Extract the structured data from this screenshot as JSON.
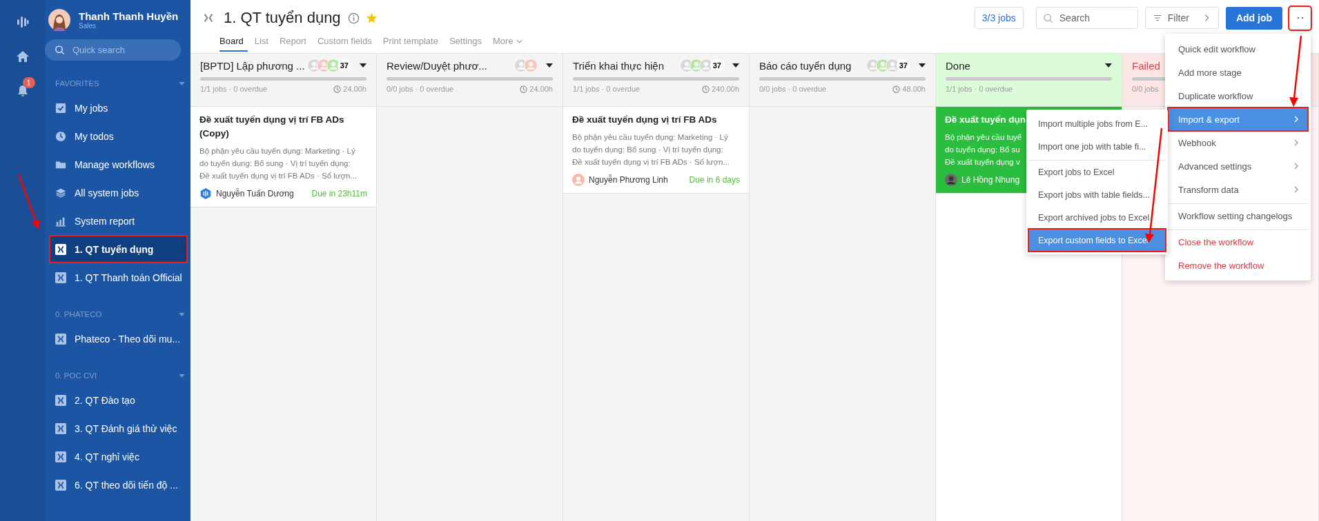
{
  "rail": {
    "notification_count": "1"
  },
  "user": {
    "name": "Thanh Thanh Huyền",
    "role": "Sales"
  },
  "quick_search": {
    "placeholder": "Quick search"
  },
  "sidebar_sections": [
    {
      "title": "FAVORITES",
      "items": [
        {
          "label": "My jobs",
          "selected": false,
          "annotated": false
        },
        {
          "label": "My todos",
          "selected": false,
          "annotated": false
        },
        {
          "label": "Manage workflows",
          "selected": false,
          "annotated": false
        },
        {
          "label": "All system jobs",
          "selected": false,
          "annotated": false
        },
        {
          "label": "System report",
          "selected": false,
          "annotated": false
        },
        {
          "label": "1. QT tuyển dụng",
          "selected": true,
          "annotated": true
        },
        {
          "label": "1. QT Thanh toán Official",
          "selected": false,
          "annotated": false
        }
      ]
    },
    {
      "title": "0. PHATECO",
      "items": [
        {
          "label": "Phateco - Theo dõi mu...",
          "selected": false,
          "annotated": false
        }
      ]
    },
    {
      "title": "0. POC CVI",
      "items": [
        {
          "label": "2. QT Đào tạo",
          "selected": false,
          "annotated": false
        },
        {
          "label": "3. QT Đánh giá thử việc",
          "selected": false,
          "annotated": false
        },
        {
          "label": "4. QT nghỉ việc",
          "selected": false,
          "annotated": false
        },
        {
          "label": "6. QT theo dõi tiến độ ...",
          "selected": false,
          "annotated": false
        }
      ]
    }
  ],
  "workflow": {
    "title": "1. QT tuyển dụng",
    "starred": true
  },
  "tabs": [
    {
      "label": "Board",
      "selected": true,
      "dropdown": false
    },
    {
      "label": "List",
      "selected": false,
      "dropdown": false
    },
    {
      "label": "Report",
      "selected": false,
      "dropdown": false
    },
    {
      "label": "Custom fields",
      "selected": false,
      "dropdown": false
    },
    {
      "label": "Print template",
      "selected": false,
      "dropdown": false
    },
    {
      "label": "Settings",
      "selected": false,
      "dropdown": false
    },
    {
      "label": "More",
      "selected": false,
      "dropdown": true
    }
  ],
  "toolbar": {
    "jobs_count": "3/3 jobs",
    "search_placeholder": "Search",
    "filter": "Filter",
    "add_job": "Add job",
    "more_annotated": true
  },
  "columns": [
    {
      "name": "[BPTD] Lập phương ...",
      "kind": "normal",
      "count": "37",
      "stats": "1/1 jobs · 0 overdue",
      "duration": "24.00h",
      "cards": [
        {
          "title": "Đề xuất tuyển dụng vị trí FB ADs (Copy)",
          "lines": [
            "Bộ phận yêu cầu tuyển dụng: Marketing · Lý",
            "do tuyển dụng: Bổ sung · Vị trí tuyển dụng:",
            "Đề xuất tuyển dụng vị trí FB ADs · Số lượn..."
          ],
          "assignee": "Nguyễn Tuấn Dương",
          "due": "Due in 23h11m"
        }
      ]
    },
    {
      "name": "Review/Duyệt phươ...",
      "kind": "normal",
      "stats": "0/0 jobs · 0 overdue",
      "duration": "24.00h"
    },
    {
      "name": "Triển khai thực hiện",
      "kind": "normal",
      "count": "37",
      "stats": "1/1 jobs · 0 overdue",
      "duration": "240.00h",
      "cards": [
        {
          "title": "Đề xuất tuyển dụng vị trí FB ADs",
          "lines": [
            "Bộ phận yêu cầu tuyển dụng: Marketing · Lý",
            "do tuyển dụng: Bổ sung · Vị trí tuyển dụng:",
            "Đề xuất tuyển dụng vị trí FB ADs · Số lượn..."
          ],
          "assignee": "Nguyễn Phương Linh",
          "due": "Due in 6 days"
        }
      ]
    },
    {
      "name": "Báo cáo tuyển dụng",
      "kind": "normal",
      "count": "37",
      "stats": "0/0 jobs · 0 overdue",
      "duration": "48.00h"
    },
    {
      "name": "Done",
      "kind": "done",
      "stats": "1/1 jobs · 0 overdue",
      "cards": [
        {
          "title": "Đề xuất tuyển dụn",
          "lines": [
            "Bộ phận yêu cầu tuyể",
            "do tuyển dụng: Bổ su",
            "Đề xuất tuyển dụng v"
          ],
          "assignee": "Lê Hồng Nhung"
        }
      ]
    },
    {
      "name": "Failed",
      "kind": "failed",
      "stats": "0/0 jobs"
    }
  ],
  "menu": [
    {
      "label": "Quick edit workflow",
      "kind": "normal",
      "submenu": false,
      "selected": false,
      "annotated": false,
      "divider_before": false
    },
    {
      "label": "Add more stage",
      "kind": "normal",
      "submenu": false,
      "selected": false,
      "annotated": false,
      "divider_before": false
    },
    {
      "label": "Duplicate workflow",
      "kind": "normal",
      "submenu": false,
      "selected": false,
      "annotated": false,
      "divider_before": false
    },
    {
      "label": "Import & export",
      "kind": "normal",
      "submenu": true,
      "selected": true,
      "annotated": true,
      "divider_before": false
    },
    {
      "label": "Webhook",
      "kind": "normal",
      "submenu": true,
      "selected": false,
      "annotated": false,
      "divider_before": false
    },
    {
      "label": "Advanced settings",
      "kind": "normal",
      "submenu": true,
      "selected": false,
      "annotated": false,
      "divider_before": false
    },
    {
      "label": "Transform data",
      "kind": "normal",
      "submenu": true,
      "selected": false,
      "annotated": false,
      "divider_before": false
    },
    {
      "label": "Workflow setting changelogs",
      "kind": "normal",
      "submenu": false,
      "selected": false,
      "annotated": false,
      "divider_before": true
    },
    {
      "label": "Close the workflow",
      "kind": "danger",
      "submenu": false,
      "selected": false,
      "annotated": false,
      "divider_before": true
    },
    {
      "label": "Remove the workflow",
      "kind": "danger",
      "submenu": false,
      "selected": false,
      "annotated": false,
      "divider_before": false
    }
  ],
  "submenu": [
    {
      "label": "Import multiple jobs from E...",
      "selected": false,
      "annotated": false,
      "divider_before": false
    },
    {
      "label": "Import one job with table fi...",
      "selected": false,
      "annotated": false,
      "divider_before": false
    },
    {
      "label": "Export jobs to Excel",
      "selected": false,
      "annotated": false,
      "divider_before": true
    },
    {
      "label": "Export jobs with table fields...",
      "selected": false,
      "annotated": false,
      "divider_before": false
    },
    {
      "label": "Export archived jobs to Excel",
      "selected": false,
      "annotated": false,
      "divider_before": false
    },
    {
      "label": "Export custom fields to Excel",
      "selected": true,
      "annotated": true,
      "divider_before": false
    }
  ]
}
